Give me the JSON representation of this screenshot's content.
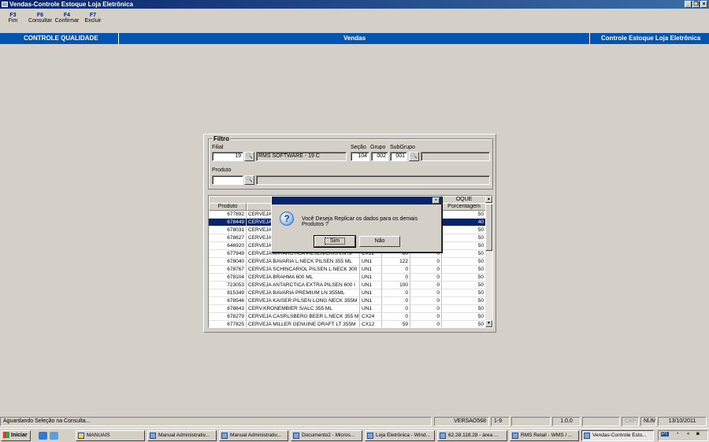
{
  "window": {
    "title": "Vendas-Controle Estoque Loja Eletrônica"
  },
  "fkeys": [
    {
      "key": "F3",
      "label": "Fim"
    },
    {
      "key": "F6",
      "label": "Consultar"
    },
    {
      "key": "F4",
      "label": "Confirmar"
    },
    {
      "key": "F7",
      "label": "Excluir"
    }
  ],
  "header": {
    "left": "CONTROLE QUALIDADE",
    "center": "Vendas",
    "right": "Controle Estoque Loja Eletrônica"
  },
  "filtro": {
    "title": "Filtro",
    "filial_label": "Filial",
    "filial_value": "19",
    "filial_desc": "RMS SOFTWARE  - 19 C",
    "secao_label": "Seção",
    "secao_value": "104",
    "grupo_label": "Grupo",
    "grupo_value": "002",
    "subgrupo_label": "SubGrupo",
    "subgrupo_value": "001",
    "produto_label": "Produto",
    "produto_value": "",
    "produto_desc": ""
  },
  "grid": {
    "group_header": "OQUE",
    "col_produto": "Produto",
    "col_porcentagem": "Porcentagem",
    "rows": [
      {
        "code": "677892",
        "desc": "CERVEJA",
        "un": "",
        "q1": "",
        "q2": "",
        "pct": "50"
      },
      {
        "code": "678449",
        "desc": "CERVEJA",
        "un": "",
        "q1": "",
        "q2": "",
        "pct": "40"
      },
      {
        "code": "678031",
        "desc": "CERVEJA",
        "un": "",
        "q1": "",
        "q2": "",
        "pct": "50"
      },
      {
        "code": "678627",
        "desc": "CERVEJA",
        "un": "",
        "q1": "",
        "q2": "",
        "pct": "50"
      },
      {
        "code": "646920",
        "desc": "CERVEJA",
        "un": "",
        "q1": "",
        "q2": "",
        "pct": "50"
      },
      {
        "code": "677949",
        "desc": "CERVEJA ANTARCTICA PILSEN/CRIS LN SI",
        "un": "CX12",
        "q1": "80",
        "q2": "0",
        "pct": "50"
      },
      {
        "code": "678040",
        "desc": "CERVEJA BAVARIA L.NECK PILSEN 355 ML",
        "un": "UN1",
        "q1": "122",
        "q2": "0",
        "pct": "50"
      },
      {
        "code": "678767",
        "desc": "CERVEJA SCHINCARIOL PILSEN L.NECK 300",
        "un": "UN1",
        "q1": "0",
        "q2": "0",
        "pct": "50"
      },
      {
        "code": "678104",
        "desc": "CERVEJA BRAHMA 600 ML",
        "un": "UN1",
        "q1": "0",
        "q2": "0",
        "pct": "50"
      },
      {
        "code": "723053",
        "desc": "CERVEJA ANTARCTICA EXTRA PILSEN 600 I",
        "un": "UN1",
        "q1": "100",
        "q2": "0",
        "pct": "50"
      },
      {
        "code": "815349",
        "desc": "CERVEJA BAVARIA PREMIUM LN 355ML",
        "un": "UN1",
        "q1": "0",
        "q2": "0",
        "pct": "50"
      },
      {
        "code": "678546",
        "desc": "CERVEJA KAISER PILSEN LONG NECK 355M",
        "un": "UN1",
        "q1": "0",
        "q2": "0",
        "pct": "50"
      },
      {
        "code": "678643",
        "desc": "CERV.KRONEMBIER S/ALC 355 ML",
        "un": "UN1",
        "q1": "0",
        "q2": "0",
        "pct": "50"
      },
      {
        "code": "678279",
        "desc": "CERVEJA CASRLSBERG BEER L.NECK 355 M",
        "un": "CX24",
        "q1": "0",
        "q2": "0",
        "pct": "50"
      },
      {
        "code": "677825",
        "desc": "CERVEJA MILLER GENUINE DRAFT LT 355M",
        "un": "CX12",
        "q1": "59",
        "q2": "0",
        "pct": "50"
      }
    ]
  },
  "dialog": {
    "message": "Você Deseja Replicar os dados para os demais Produtos ?",
    "yes": "Sim",
    "no": "Não",
    "close": "×"
  },
  "status": {
    "message": "Aguardando Seleção na Consulta...",
    "version": "VERSAO568",
    "range": "1-9",
    "build": "1.0.0",
    "caps": "CAPS",
    "num": "NUM",
    "date": "13/10/2011"
  },
  "taskbar": {
    "start": "Iniciar",
    "items": [
      "MANUAIS",
      "Manual Administrativ...",
      "Manual Administrativ...",
      "Documento2 - Micros...",
      "Loja Eletrônica - Wind...",
      "62.28.118.28 - área ...",
      "RMS Retail - WMS / ...",
      "Vendas-Controle Esto..."
    ],
    "lang": "PT"
  }
}
